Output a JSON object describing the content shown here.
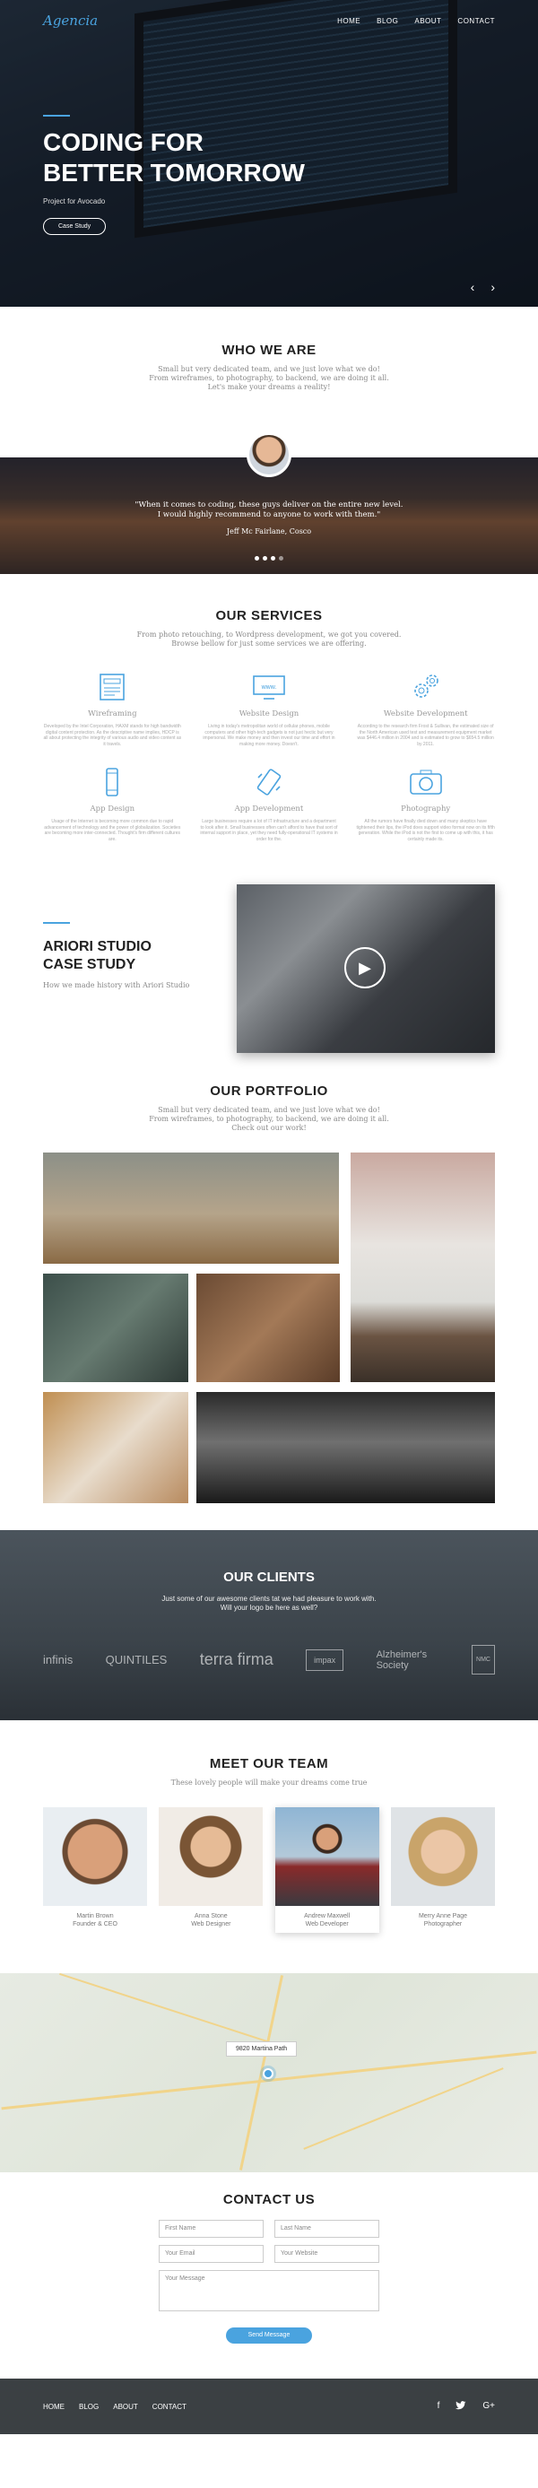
{
  "header": {
    "logo": "Agencia",
    "nav": [
      "HOME",
      "BLOG",
      "ABOUT",
      "CONTACT"
    ]
  },
  "hero": {
    "title_line1": "CODING FOR",
    "title_line2": "BETTER TOMORROW",
    "subtitle": "Project for Avocado",
    "button": "Case Study",
    "prev_arrow": "‹",
    "next_arrow": "›"
  },
  "who": {
    "title": "WHO WE ARE",
    "text": "Small but very dedicated team, and we just love what we do!\nFrom wireframes, to photography, to backend, we are doing it all.\nLet's make your dreams a reality!"
  },
  "testimonial": {
    "quote": "\"When it comes to coding, these guys deliver on the entire new level.\nI would highly recommend to anyone to work with them.\"",
    "author": "Jeff Mc Fairlane, Cosco"
  },
  "services": {
    "title": "OUR SERVICES",
    "subtitle": "From photo retouching, to Wordpress development, we got you covered.\nBrowse bellow for just some services we are offering.",
    "items": [
      {
        "name": "Wireframing",
        "icon": "wireframe-icon",
        "desc": "Developed by the Intel Corporation, HAXM stands for high bandwidth digital content protection. As the descriptive name implies, HDCP is all about protecting the integrity of various audio and video content as it travels."
      },
      {
        "name": "Website Design",
        "icon": "website-design-icon",
        "desc": "Living in today's metropolitan world of cellular phones, mobile computers and other high-tech gadgets is not just hectic but very impersonal. We make money and then invest our time and effort in making more money. Doesn't."
      },
      {
        "name": "Website Development",
        "icon": "gears-icon",
        "desc": "According to the research firm Frost & Sullivan, the estimated size of the North American used test and measurement equipment market was $446.4 million in 2004 and is estimated to grow to $654.5 million by 2011."
      },
      {
        "name": "App Design",
        "icon": "mobile-icon",
        "desc": "Usage of the Internet is becoming more common due to rapid advancement of technology and the power of globalization. Societies are becoming more inter-connected. Thought's firm different cultures are."
      },
      {
        "name": "App Development",
        "icon": "app-development-icon",
        "desc": "Large businesses require a lot of IT infrastructure and a department to look after it. Small businesses often can't afford to have that sort of internal support in place, yet they need fully-operational IT systems in order for the."
      },
      {
        "name": "Photography",
        "icon": "camera-icon",
        "desc": "All the rumors have finally died down and many skeptics have tightened their lips, the iPod does support video format now on its fifth generation. While the iPod is not the first to come up with this, it has certainly made its."
      }
    ]
  },
  "case_study": {
    "title_line1": "ARIORI STUDIO",
    "title_line2": "CASE STUDY",
    "subtitle": "How we made history with Ariori Studio"
  },
  "portfolio": {
    "title": "OUR PORTFOLIO",
    "text": "Small but very dedicated team, and we just love what we do!\nFrom wireframes, to photography, to backend, we are doing it all.\nCheck out our work!"
  },
  "clients": {
    "title": "OUR CLIENTS",
    "text": "Just some of our awesome clients tat we had pleasure to work with.\nWill your logo be here as well?",
    "logos": [
      "infinis",
      "QUINTILES",
      "terra firma",
      "impax",
      "Alzheimer's Society",
      "NMC"
    ]
  },
  "team": {
    "title": "MEET OUR TEAM",
    "subtitle": "These lovely people will make your dreams come true",
    "members": [
      {
        "name": "Martin Brown",
        "role": "Founder & CEO"
      },
      {
        "name": "Anna Stone",
        "role": "Web Designer"
      },
      {
        "name": "Andrew Maxwell",
        "role": "Web Developer"
      },
      {
        "name": "Merry Anne Page",
        "role": "Photographer"
      }
    ]
  },
  "map": {
    "address": "9820 Martina Path"
  },
  "contact": {
    "title": "CONTACT US",
    "first_name": "First Name",
    "last_name": "Last Name",
    "email": "Your Email",
    "website": "Your Website",
    "message": "Your Message",
    "send": "Send Message"
  },
  "footer": {
    "links": [
      "HOME",
      "BLOG",
      "ABOUT",
      "CONTACT"
    ],
    "social": [
      "f",
      "t",
      "G+"
    ]
  },
  "colors": {
    "accent": "#4aa3df",
    "footer_bg": "#3b4043"
  }
}
